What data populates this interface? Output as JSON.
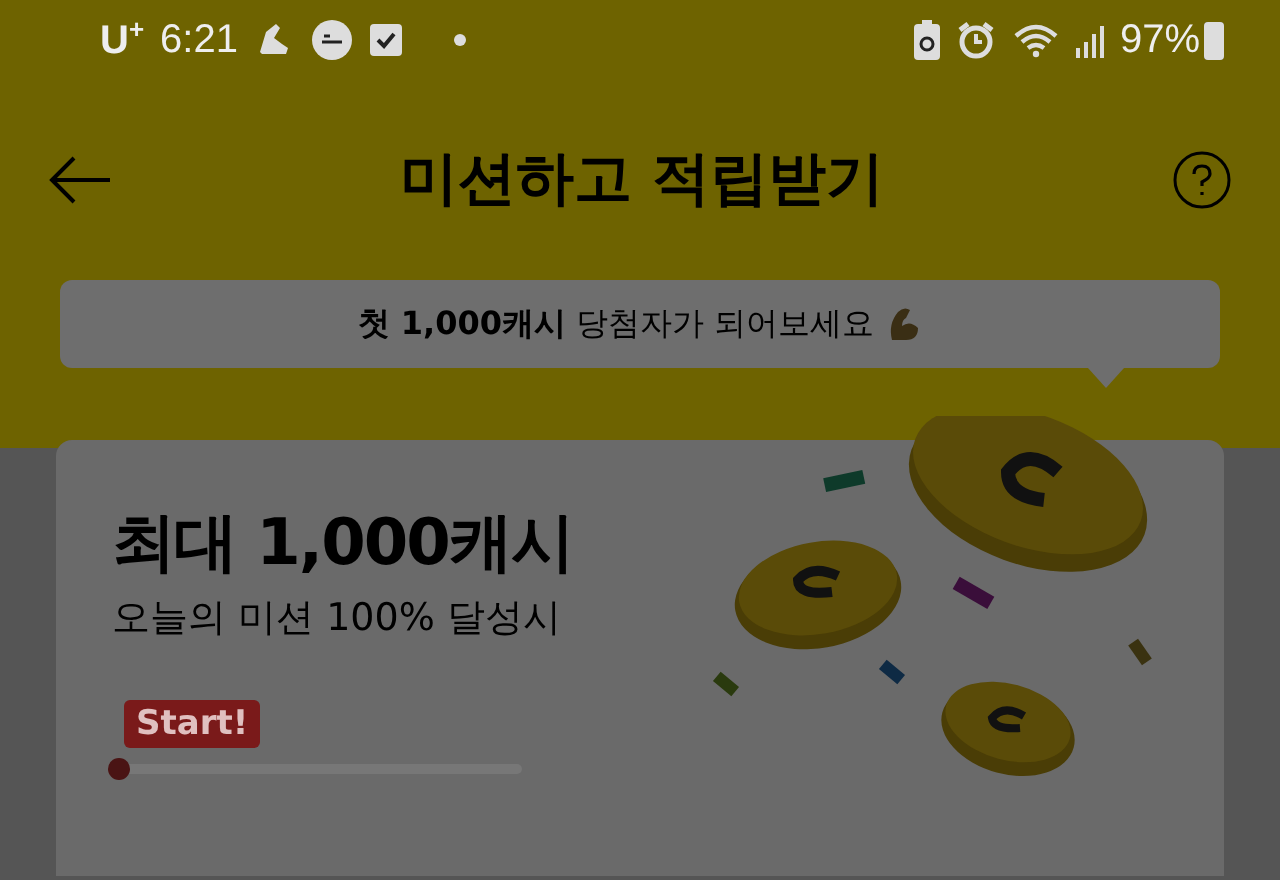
{
  "status_bar": {
    "carrier": "U$^{+}$",
    "time": "6:21",
    "battery": "97%"
  },
  "header": {
    "title": "미션하고 적립받기"
  },
  "banner": {
    "text": "**첫 1,000캐시** 당첨자가 되어보세요"
  },
  "card": {
    "title": "최대 1,000캐시",
    "subtitle": "오늘의 미션 100% 달성시",
    "badge": "Start!",
    "progress": {
      "level": 0
    }
  }
}
